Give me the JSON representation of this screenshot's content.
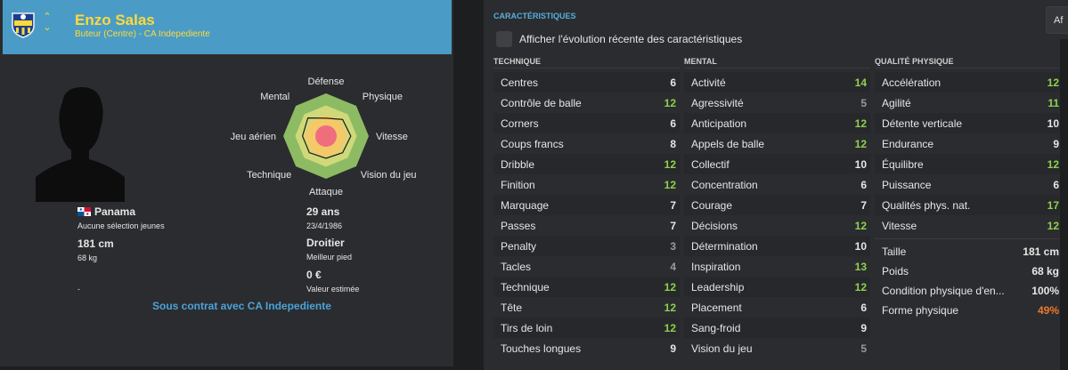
{
  "player": {
    "name": "Enzo Salas",
    "role": "Buteur (Centre) - CA Indepediente",
    "nationality": "Panama",
    "youth_caps": "Aucune sélection jeunes",
    "height": "181 cm",
    "weight": "68 kg",
    "age": "29 ans",
    "birthdate": "23/4/1986",
    "foot": "Droitier",
    "foot_label": "Meilleur pied",
    "value": "0 €",
    "value_label": "Valeur estimée",
    "dash": "-",
    "contract": "Sous contrat avec CA Indepediente"
  },
  "radar": {
    "labels": [
      "Défense",
      "Physique",
      "Vitesse",
      "Vision du jeu",
      "Attaque",
      "Technique",
      "Jeu aérien",
      "Mental"
    ]
  },
  "attributes": {
    "section_title": "CARACTÉRISTIQUES",
    "af_button": "Af",
    "evolution_label": "Afficher l'évolution récente des caractéristiques",
    "technical_title": "TECHNIQUE",
    "mental_title": "MENTAL",
    "physical_title": "QUALITÉ PHYSIQUE",
    "technical": [
      {
        "name": "Centres",
        "value": "6"
      },
      {
        "name": "Contrôle de balle",
        "value": "12"
      },
      {
        "name": "Corners",
        "value": "6"
      },
      {
        "name": "Coups francs",
        "value": "8"
      },
      {
        "name": "Dribble",
        "value": "12"
      },
      {
        "name": "Finition",
        "value": "12"
      },
      {
        "name": "Marquage",
        "value": "7"
      },
      {
        "name": "Passes",
        "value": "7"
      },
      {
        "name": "Penalty",
        "value": "3"
      },
      {
        "name": "Tacles",
        "value": "4"
      },
      {
        "name": "Technique",
        "value": "12"
      },
      {
        "name": "Tête",
        "value": "12"
      },
      {
        "name": "Tirs de loin",
        "value": "12"
      },
      {
        "name": "Touches longues",
        "value": "9"
      }
    ],
    "mental": [
      {
        "name": "Activité",
        "value": "14"
      },
      {
        "name": "Agressivité",
        "value": "5"
      },
      {
        "name": "Anticipation",
        "value": "12"
      },
      {
        "name": "Appels de balle",
        "value": "12"
      },
      {
        "name": "Collectif",
        "value": "10"
      },
      {
        "name": "Concentration",
        "value": "6"
      },
      {
        "name": "Courage",
        "value": "7"
      },
      {
        "name": "Décisions",
        "value": "12"
      },
      {
        "name": "Détermination",
        "value": "10"
      },
      {
        "name": "Inspiration",
        "value": "13"
      },
      {
        "name": "Leadership",
        "value": "12"
      },
      {
        "name": "Placement",
        "value": "6"
      },
      {
        "name": "Sang-froid",
        "value": "9"
      },
      {
        "name": "Vision du jeu",
        "value": "5"
      }
    ],
    "physical": [
      {
        "name": "Accélération",
        "value": "12"
      },
      {
        "name": "Agilité",
        "value": "11"
      },
      {
        "name": "Détente verticale",
        "value": "10"
      },
      {
        "name": "Endurance",
        "value": "9"
      },
      {
        "name": "Équilibre",
        "value": "12"
      },
      {
        "name": "Puissance",
        "value": "6"
      },
      {
        "name": "Qualités phys. nat.",
        "value": "17"
      },
      {
        "name": "Vitesse",
        "value": "12"
      }
    ],
    "extra": [
      {
        "name": "Taille",
        "value": "181 cm"
      },
      {
        "name": "Poids",
        "value": "68 kg"
      },
      {
        "name": "Condition physique d'en...",
        "value": "100%"
      },
      {
        "name": "Forme physique",
        "value": "49%"
      }
    ]
  },
  "colors": {
    "header": "#4a9cc6",
    "name": "#ffd93b",
    "good": "#8fd14f",
    "normal": "#e6e6e6",
    "poor": "#9a9a9a",
    "orange": "#ee7a2a",
    "contract": "#4aa3d8"
  }
}
